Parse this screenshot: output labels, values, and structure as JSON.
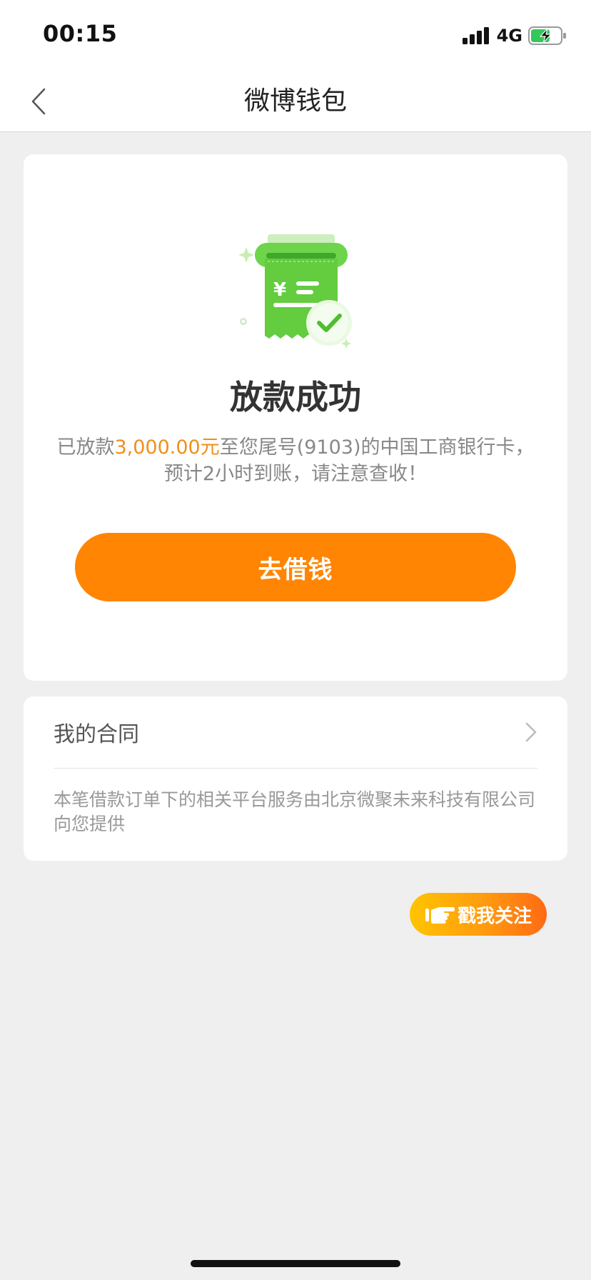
{
  "status_bar": {
    "time": "00:15",
    "network": "4G",
    "icons": [
      "signal-icon",
      "battery-charging-icon"
    ]
  },
  "nav": {
    "title": "微博钱包",
    "back_icon": "chevron-left-icon"
  },
  "success": {
    "illustration_icon": "receipt-check-icon",
    "title": "放款成功",
    "desc_prefix": "已放款",
    "amount": "3,000.00元",
    "desc_suffix": "至您尾号(9103)的中国工商银行卡，",
    "desc_line2": "预计2小时到账，请注意查收！",
    "button_label": "去借钱"
  },
  "contract": {
    "label": "我的合同",
    "chevron_icon": "chevron-right-icon",
    "note": "本笔借款订单下的相关平台服务由北京微聚未来科技有限公司向您提供"
  },
  "follow": {
    "label": "戳我关注",
    "icon": "pointing-hand-icon"
  },
  "colors": {
    "accent": "#ff8503",
    "amount": "#f08f1c",
    "success_green": "#5fcf3a",
    "background": "#efefef"
  }
}
